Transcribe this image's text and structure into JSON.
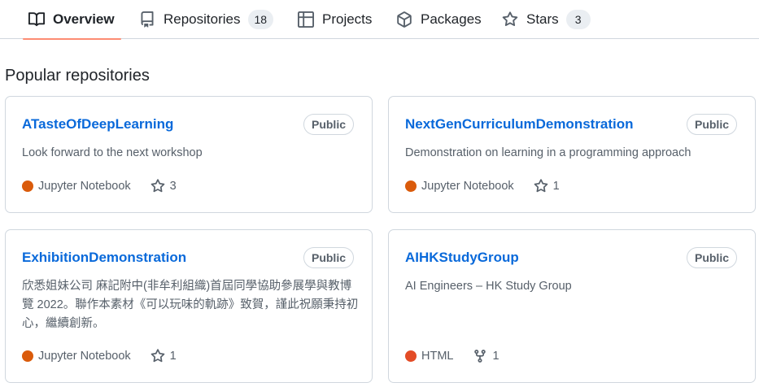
{
  "tabs": [
    {
      "label": "Overview",
      "icon": "book-icon",
      "active": true
    },
    {
      "label": "Repositories",
      "icon": "repo-icon",
      "count": "18"
    },
    {
      "label": "Projects",
      "icon": "table-icon"
    },
    {
      "label": "Packages",
      "icon": "package-icon"
    },
    {
      "label": "Stars",
      "icon": "star-icon",
      "count": "3"
    }
  ],
  "section_title": "Popular repositories",
  "repos": [
    {
      "name": "ATasteOfDeepLearning",
      "visibility": "Public",
      "description": "Look forward to the next workshop",
      "language": "Jupyter Notebook",
      "language_color": "#DA5B0B",
      "stat_icon": "star-icon",
      "stat": "3"
    },
    {
      "name": "NextGenCurriculumDemonstration",
      "visibility": "Public",
      "description": "Demonstration on learning in a programming approach",
      "language": "Jupyter Notebook",
      "language_color": "#DA5B0B",
      "stat_icon": "star-icon",
      "stat": "1"
    },
    {
      "name": "ExhibitionDemonstration",
      "visibility": "Public",
      "description": "欣悉姐妹公司 麻記附中(非牟利組織)首屆同學協助參展學與教博覽 2022。聯作本素材《可以玩味的軌跡》致賀，謹此祝願秉持初心，繼續創新。",
      "language": "Jupyter Notebook",
      "language_color": "#DA5B0B",
      "stat_icon": "star-icon",
      "stat": "1"
    },
    {
      "name": "AIHKStudyGroup",
      "visibility": "Public",
      "description": "AI Engineers – HK Study Group",
      "language": "HTML",
      "language_color": "#e34c26",
      "stat_icon": "fork-icon",
      "stat": "1"
    }
  ]
}
